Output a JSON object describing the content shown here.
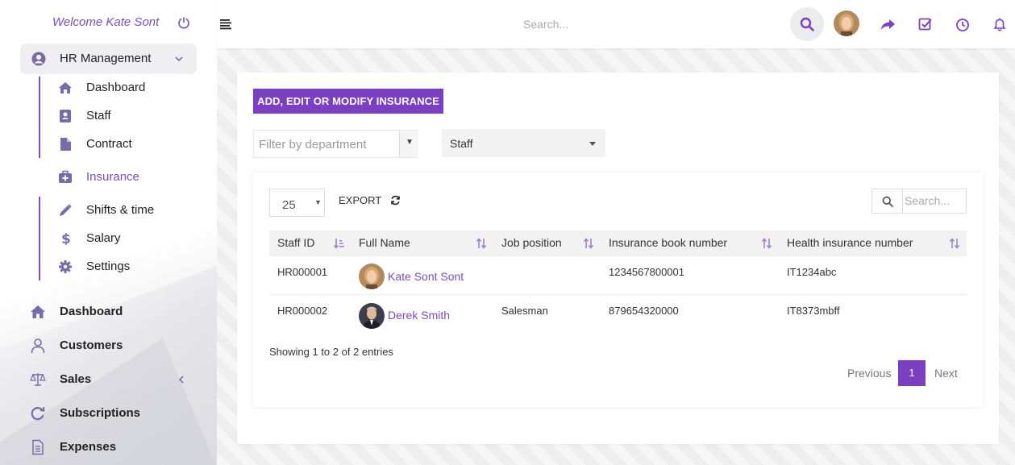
{
  "sidebar": {
    "welcome": "Welcome Kate Sont",
    "hr_module": {
      "label": "HR Management",
      "items": [
        {
          "label": "Dashboard",
          "icon": "home-icon"
        },
        {
          "label": "Staff",
          "icon": "contact-book-icon"
        },
        {
          "label": "Contract",
          "icon": "file-icon"
        },
        {
          "label": "Insurance",
          "icon": "medkit-icon",
          "active": true
        },
        {
          "label": "Shifts & time",
          "icon": "pencil-icon"
        },
        {
          "label": "Salary",
          "icon": "dollar-icon"
        },
        {
          "label": "Settings",
          "icon": "gear-icon"
        }
      ]
    },
    "main_items": [
      {
        "label": "Dashboard",
        "icon": "home-icon"
      },
      {
        "label": "Customers",
        "icon": "user-icon"
      },
      {
        "label": "Sales",
        "icon": "balance-scale-icon"
      },
      {
        "label": "Subscriptions",
        "icon": "refresh-icon"
      },
      {
        "label": "Expenses",
        "icon": "document-icon"
      }
    ]
  },
  "topbar": {
    "search_placeholder": "Search..."
  },
  "content": {
    "add_button": "ADD, EDIT OR MODIFY INSURANCE",
    "filter_department_placeholder": "Filter by department",
    "staff_select": "Staff",
    "table": {
      "page_length": "25",
      "export_label": "EXPORT",
      "search_placeholder": "Search...",
      "columns": [
        "Staff ID",
        "Full Name",
        "Job position",
        "Insurance book number",
        "Health insurance number"
      ],
      "rows": [
        {
          "staff_id": "HR000001",
          "full_name": "Kate Sont Sont",
          "job_position": "",
          "insurance_book": "1234567800001",
          "health_insurance": "IT1234abc"
        },
        {
          "staff_id": "HR000002",
          "full_name": "Derek Smith",
          "job_position": "Salesman",
          "insurance_book": "879654320000",
          "health_insurance": "IT8373mbff"
        }
      ],
      "info": "Showing 1 to 2 of 2 entries",
      "pagination": {
        "previous": "Previous",
        "current": "1",
        "next": "Next"
      }
    }
  },
  "colors": {
    "accent": "#7b3fc2",
    "link": "#7a4fb6"
  }
}
